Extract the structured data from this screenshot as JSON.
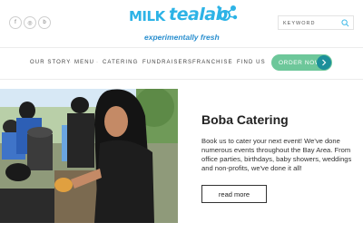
{
  "header": {
    "social": [
      {
        "name": "facebook-icon",
        "glyph": "f"
      },
      {
        "name": "instagram-icon",
        "glyph": "◎"
      },
      {
        "name": "blog-icon",
        "glyph": "b"
      }
    ],
    "logo": {
      "milk": "MILK",
      "tealab": "tealab",
      "tagline": "experimentally fresh",
      "color": "#2db3e6"
    },
    "search": {
      "placeholder": "KEYWORD"
    }
  },
  "nav": {
    "items": [
      "OUR STORY",
      "MENU",
      "CATERING",
      "FUNDRAISERS",
      "FRANCHISE",
      "FIND US"
    ],
    "order_button": "ORDER NOW",
    "order_color": "#6dc79a"
  },
  "main": {
    "title": "Boba Catering",
    "description": "Book us to cater your next event! We've done numerous events throughout the Bay Area. From office parties, birthdays, baby showers, weddings and non-profits, we've done it all!",
    "read_more": "read more"
  }
}
